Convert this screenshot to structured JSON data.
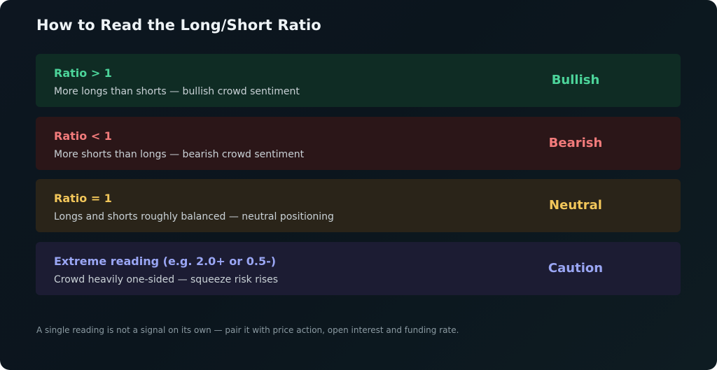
{
  "title": "How to Read the Long/Short Ratio",
  "rows": [
    {
      "label": "Ratio > 1",
      "description": "More longs than shorts — bullish crowd sentiment",
      "tag": "Bullish",
      "accent": "#4cd49a",
      "background": "#0f2c24"
    },
    {
      "label": "Ratio < 1",
      "description": "More shorts than longs — bearish crowd sentiment",
      "tag": "Bearish",
      "accent": "#f27b7b",
      "background": "#2b1618"
    },
    {
      "label": "Ratio = 1",
      "description": "Longs and shorts roughly balanced — neutral positioning",
      "tag": "Neutral",
      "accent": "#f2c65a",
      "background": "#2a2419"
    },
    {
      "label": "Extreme reading (e.g. 2.0+ or 0.5-)",
      "description": "Crowd heavily one-sided — squeeze risk rises",
      "tag": "Caution",
      "accent": "#9aa6f4",
      "background": "#1c1c33"
    }
  ],
  "footnote": "A single reading is not a signal on its own — pair it with price action, open interest and funding rate."
}
